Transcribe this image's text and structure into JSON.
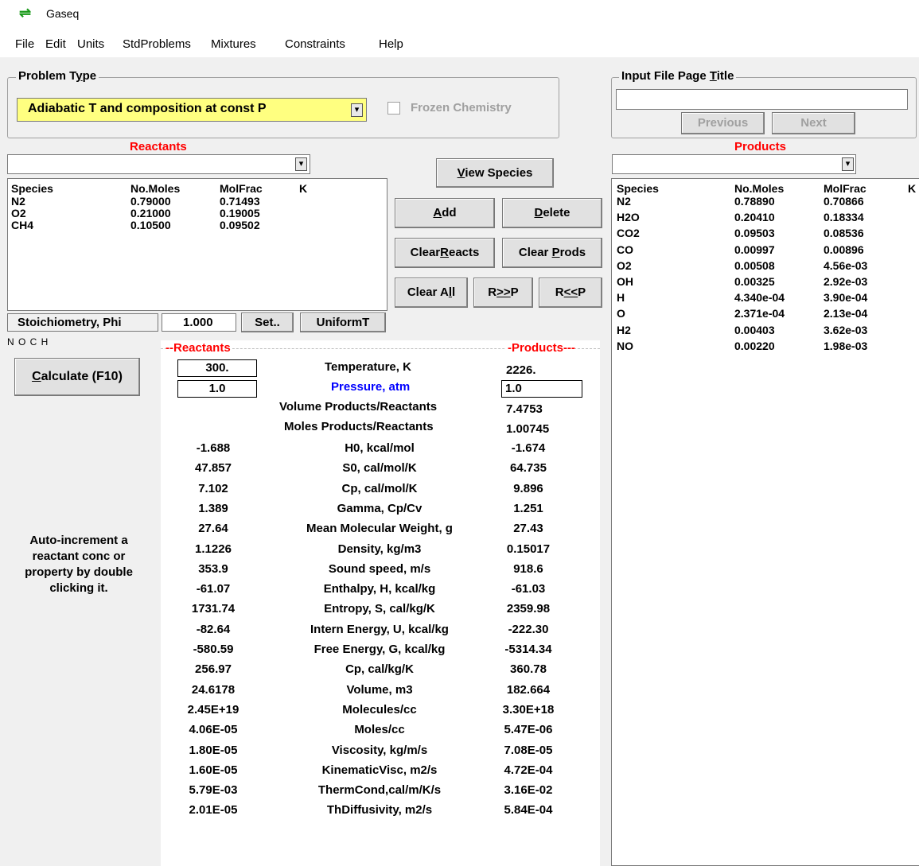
{
  "window": {
    "title": "Gaseq",
    "icon": "exchange-arrows-icon"
  },
  "menu": [
    "File",
    "Edit",
    "Units",
    "StdProblems",
    "Mixtures",
    "Constraints",
    "Help"
  ],
  "problem_type": {
    "group_label": "Problem Type",
    "selected": "Adiabatic T and composition at const P",
    "frozen_label": "Frozen Chemistry"
  },
  "input_file": {
    "group_label": "Input File Page Title",
    "title_value": "",
    "previous_label": "Previous",
    "next_label": "Next"
  },
  "reactants": {
    "heading": "Reactants",
    "combo_value": "",
    "columns": [
      "Species",
      "No.Moles",
      "MolFrac",
      "K"
    ],
    "rows": [
      [
        "N2",
        "0.79000",
        "0.71493"
      ],
      [
        "O2",
        "0.21000",
        "0.19005"
      ],
      [
        "CH4",
        "0.10500",
        "0.09502"
      ]
    ]
  },
  "products": {
    "heading": "Products",
    "combo_value": "",
    "columns": [
      "Species",
      "No.Moles",
      "MolFrac",
      "K"
    ],
    "rows": [
      [
        "N2",
        "0.78890",
        "0.70866"
      ],
      [
        "H2O",
        "0.20410",
        "0.18334"
      ],
      [
        "CO2",
        "0.09503",
        "0.08536"
      ],
      [
        "CO",
        "0.00997",
        "0.00896"
      ],
      [
        "O2",
        "0.00508",
        "4.56e-03"
      ],
      [
        "OH",
        "0.00325",
        "2.92e-03"
      ],
      [
        "H",
        "4.340e-04",
        "3.90e-04"
      ],
      [
        "O",
        "2.371e-04",
        "2.13e-04"
      ],
      [
        "H2",
        "0.00403",
        "3.62e-03"
      ],
      [
        "NO",
        "0.00220",
        "1.98e-03"
      ]
    ]
  },
  "buttons": {
    "view_species": "View Species",
    "add": "Add",
    "delete": "Delete",
    "clear_reacts": "ClearReacts",
    "clear_prods": "Clear Prods",
    "clear_all": "Clear All",
    "r_to_p": "R>>P",
    "p_to_r": "R<<P",
    "calculate": "Calculate (F10)",
    "set": "Set..",
    "uniform_t": "UniformT"
  },
  "stoich": {
    "label": "Stoichiometry, Phi",
    "value": "1.000"
  },
  "noch_label": "N O C H",
  "auto_increment_note": "Auto-increment a reactant conc or property by double clicking it.",
  "results": {
    "header_reactants": "--Reactants",
    "header_products": "-Products---",
    "temperature": {
      "label": "Temperature, K",
      "reactant": "300.",
      "product": "2226."
    },
    "pressure": {
      "label": "Pressure, atm",
      "reactant": "1.0",
      "product": "1.0"
    },
    "volume_ratio": {
      "label": "Volume Products/Reactants",
      "product": "7.4753"
    },
    "moles_ratio": {
      "label": "Moles Products/Reactants",
      "product": "1.00745"
    },
    "rows": [
      {
        "r": "-1.688",
        "label": "H0,  kcal/mol",
        "p": "-1.674"
      },
      {
        "r": "47.857",
        "label": "S0,  cal/mol/K",
        "p": "64.735"
      },
      {
        "r": "7.102",
        "label": "Cp,  cal/mol/K",
        "p": "9.896"
      },
      {
        "r": "1.389",
        "label": "Gamma, Cp/Cv",
        "p": "1.251"
      },
      {
        "r": "27.64",
        "label": "Mean Molecular Weight, g",
        "p": "27.43"
      },
      {
        "r": "1.1226",
        "label": "Density,  kg/m3",
        "p": "0.15017"
      },
      {
        "r": "353.9",
        "label": "Sound speed,  m/s",
        "p": "918.6"
      },
      {
        "r": "-61.07",
        "label": "Enthalpy, H,  kcal/kg",
        "p": "-61.03"
      },
      {
        "r": "1731.74",
        "label": "Entropy,  S,  cal/kg/K",
        "p": "2359.98"
      },
      {
        "r": "-82.64",
        "label": "Intern Energy, U,  kcal/kg",
        "p": "-222.30"
      },
      {
        "r": "-580.59",
        "label": "Free Energy, G, kcal/kg",
        "p": "-5314.34"
      },
      {
        "r": "256.97",
        "label": "Cp, cal/kg/K",
        "p": "360.78"
      },
      {
        "r": "24.6178",
        "label": "Volume,  m3",
        "p": "182.664"
      },
      {
        "r": "2.45E+19",
        "label": "Molecules/cc",
        "p": "3.30E+18"
      },
      {
        "r": "4.06E-05",
        "label": "Moles/cc",
        "p": "5.47E-06"
      },
      {
        "r": "1.80E-05",
        "label": "Viscosity,  kg/m/s",
        "p": "7.08E-05"
      },
      {
        "r": "1.60E-05",
        "label": "KinematicVisc,  m2/s",
        "p": "4.72E-04"
      },
      {
        "r": "5.79E-03",
        "label": "ThermCond,cal/m/K/s",
        "p": "3.16E-02"
      },
      {
        "r": "2.01E-05",
        "label": "ThDiffusivity,  m2/s",
        "p": "5.84E-04"
      }
    ]
  }
}
